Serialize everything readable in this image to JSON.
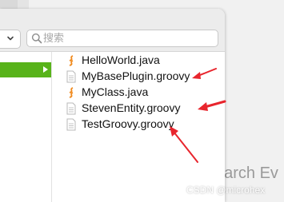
{
  "search": {
    "placeholder": "搜索",
    "value": ""
  },
  "files": [
    {
      "name": "HelloWorld.java",
      "icon": "java-file-icon"
    },
    {
      "name": "MyBasePlugin.groovy",
      "icon": "groovy-file-icon"
    },
    {
      "name": "MyClass.java",
      "icon": "java-file-icon"
    },
    {
      "name": "StevenEntity.groovy",
      "icon": "groovy-file-icon"
    },
    {
      "name": "TestGroovy.groovy",
      "icon": "groovy-file-icon"
    }
  ],
  "background_text": "earch Ev",
  "watermark": "CSDN @microhex",
  "colors": {
    "selection": "#58b31a",
    "annotation_arrow": "#e8252d",
    "java_icon": "#f08a1d"
  }
}
